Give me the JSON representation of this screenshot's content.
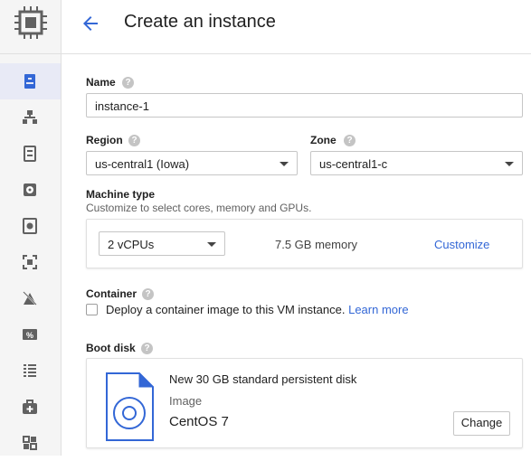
{
  "header": {
    "title": "Create an instance"
  },
  "name": {
    "label": "Name",
    "value": "instance-1"
  },
  "region": {
    "label": "Region",
    "value": "us-central1 (Iowa)"
  },
  "zone": {
    "label": "Zone",
    "value": "us-central1-c"
  },
  "machine": {
    "label": "Machine type",
    "subtitle": "Customize to select cores, memory and GPUs.",
    "cpus": "2 vCPUs",
    "memory": "7.5 GB memory",
    "customize_label": "Customize"
  },
  "container": {
    "label": "Container",
    "checkbox_text": "Deploy a container image to this VM instance.",
    "learn_more": "Learn more"
  },
  "boot_disk": {
    "label": "Boot disk",
    "title": "New 30 GB standard persistent disk",
    "image_label": "Image",
    "image_value": "CentOS 7",
    "change_label": "Change"
  },
  "help_glyph": "?",
  "colors": {
    "accent": "#3367d6",
    "active_bg": "#e8eaf6",
    "sidebar_bg": "#f5f5f5"
  },
  "sidebar_icons": [
    "chip-logo-icon",
    "vm-instances-icon",
    "instance-groups-icon",
    "instance-templates-icon",
    "disks-icon",
    "snapshots-icon",
    "images-icon",
    "tpu-icon",
    "committed-use-discounts-icon",
    "metadata-icon",
    "health-checks-icon",
    "zones-icon"
  ]
}
